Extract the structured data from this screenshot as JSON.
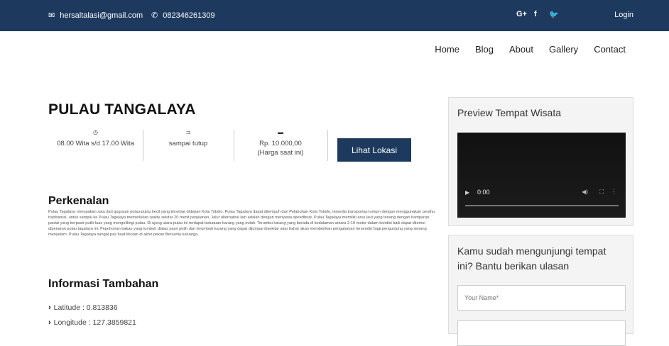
{
  "topbar": {
    "email": "hersaltalasi@gmail.com",
    "phone": "082346261309",
    "social": {
      "gplus": "G+",
      "facebook": "f",
      "twitter": "🐦"
    },
    "login": "Login"
  },
  "nav": {
    "items": [
      "Home",
      "Blog",
      "About",
      "Gallery",
      "Contact"
    ]
  },
  "place": {
    "title": "PULAU TANGALAYA",
    "hours": "08.00 Wita s/d 17.00 Wita",
    "closing": "sampai tutup",
    "price": "Rp. 10.000,00",
    "price_note": "(Harga saat ini)",
    "location_button": "Lihat Lokasi"
  },
  "intro": {
    "heading": "Perkenalan",
    "text": "Pulau Tagalaya merupakan satu dari gugusan pulau-pulau kecil yang tersebar didepan Kota Tobelo. Pulau Tagalaya dapat ditempuh dari Pelabuhan Kota Tobelo, tersedia transportasi umum dengan menggunakan perahu tradisional, untuk sampai ke Pulau Tagalaya memerlukan waktu sekitar 20 menit perjalanan. Jalur alternative lain adalah dengan menyewa speedboat. Pulau Tagalaya memiliki arus laut yang tenang dengan hamparan pantai yang berpasir putih luas yang mengelilingi pulau. Di ujung utara pulau ini terdapat bebatuan karang yang indah. Terumbu karang yang berada di kedalaman antara 2-10 meter dalam kondisi baik dapat ditemui diperairan pulau tagalaya ini. Pepohonan bakau yang tumbuh diatas pasir putih dan terumbuh karang yang dapat dijumpai disekitar akar bahar akan memberikan pengalaman tersendiri bagi pengunjung yang senang menyelam. Pulau Tagalaya sangat pas buat liburan di akhir pekan Bersama keluarga."
  },
  "extra": {
    "heading": "Informasi Tambahan",
    "latitude": "Latitude : 0.813836",
    "longitude": "Longitude : 127.3859821"
  },
  "sidebar": {
    "preview_title": "Preview Tempat Wisata",
    "video_time": "0:00",
    "review_title": "Kamu sudah mengunjungi tempat ini? Bantu berikan ulasan",
    "name_placeholder": "Your Name*"
  }
}
